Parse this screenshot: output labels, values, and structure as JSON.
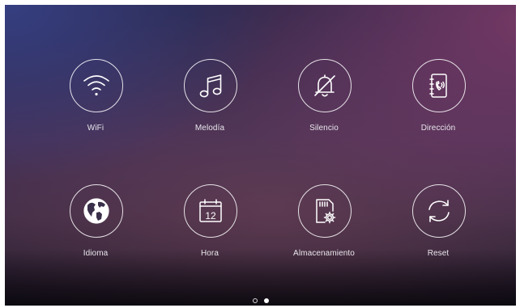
{
  "menu": {
    "items": [
      {
        "label": "WiFi",
        "icon": "wifi-icon"
      },
      {
        "label": "Melodía",
        "icon": "music-note-icon"
      },
      {
        "label": "Silencio",
        "icon": "bell-muted-icon"
      },
      {
        "label": "Dirección",
        "icon": "address-book-icon"
      },
      {
        "label": "Idioma",
        "icon": "globe-icon"
      },
      {
        "label": "Hora",
        "icon": "calendar-icon"
      },
      {
        "label": "Almacenamiento",
        "icon": "sd-card-settings-icon"
      },
      {
        "label": "Reset",
        "icon": "refresh-icon"
      }
    ]
  },
  "calendar_icon": {
    "day": "12"
  },
  "pagination": {
    "total_pages": 2,
    "current_page": 2
  },
  "colors": {
    "icon_stroke": "#ffffff",
    "label_text": "#e8e6ec",
    "background_top_left": "#364084",
    "background_right": "#8c3e6e"
  }
}
